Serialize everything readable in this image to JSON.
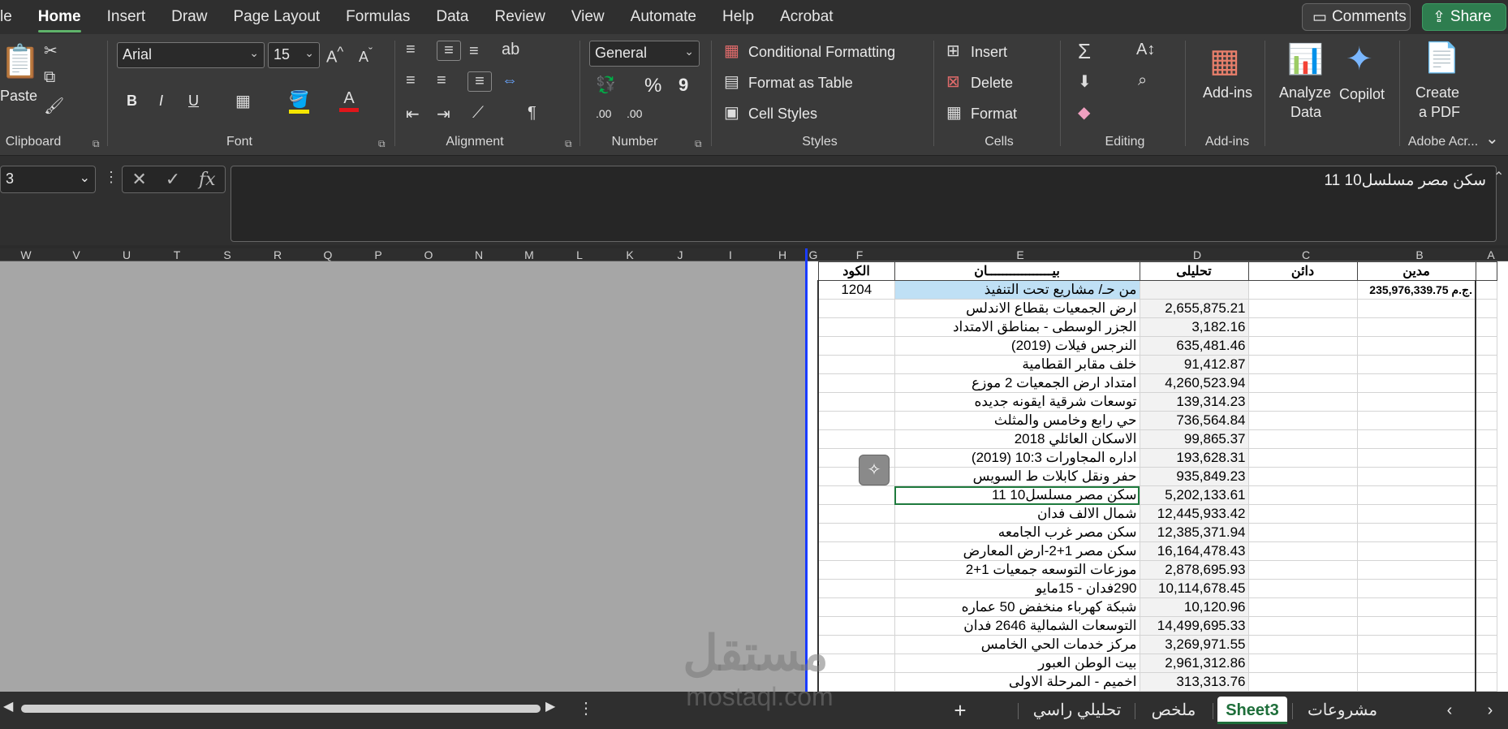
{
  "menubar": {
    "items": [
      "le",
      "Home",
      "Insert",
      "Draw",
      "Page Layout",
      "Formulas",
      "Data",
      "Review",
      "View",
      "Automate",
      "Help",
      "Acrobat"
    ],
    "comments": "Comments",
    "share": "Share"
  },
  "ribbon": {
    "clipboard": {
      "paste": "Paste",
      "label": "Clipboard"
    },
    "font": {
      "name": "Arial",
      "size": "15",
      "label": "Font",
      "bold": "B",
      "italic": "I",
      "underline": "U"
    },
    "alignment": {
      "label": "Alignment"
    },
    "number": {
      "format": "General",
      "label": "Number",
      "percent": "%",
      "comma": "9",
      "inc": ".00",
      "dec": ".00"
    },
    "styles": {
      "conditional": "Conditional Formatting",
      "format_table": "Format as Table",
      "cell_styles": "Cell Styles",
      "label": "Styles"
    },
    "cells": {
      "insert": "Insert",
      "delete": "Delete",
      "format": "Format",
      "label": "Cells"
    },
    "editing": {
      "label": "Editing"
    },
    "addins": {
      "title": "Add-ins",
      "label": "Add-ins"
    },
    "analyze": {
      "line1": "Analyze",
      "line2": "Data"
    },
    "copilot": {
      "title": "Copilot"
    },
    "acrobat": {
      "line1": "Create",
      "line2": "a PDF",
      "label": "Adobe Acr..."
    }
  },
  "formula_bar": {
    "namebox": "3",
    "fx": "fx",
    "content": "سكن مصر مسلسل10 11"
  },
  "columns": [
    "W",
    "V",
    "U",
    "T",
    "S",
    "R",
    "Q",
    "P",
    "O",
    "N",
    "M",
    "L",
    "K",
    "J",
    "I",
    "H",
    "G",
    "F",
    "E",
    "D",
    "C",
    "B",
    "A"
  ],
  "table": {
    "headers": {
      "code": "الكود",
      "statement": "بيـــــــــــــــــان",
      "analytic": "تحليلى",
      "credit": "دائن",
      "debit": "مدين"
    },
    "first_row": {
      "code": "1204",
      "statement": "من حـ/ مشاريع تحت التنفيذ",
      "debit": "235,976,339.75 ج.م."
    },
    "rows": [
      {
        "statement": "ارض الجمعيات بقطاع الاندلس",
        "value": "2,655,875.21"
      },
      {
        "statement": "الجزر الوسطى - بمناطق الامتداد",
        "value": "3,182.16"
      },
      {
        "statement": "النرجس فيلات (2019)",
        "value": "635,481.46"
      },
      {
        "statement": "خلف مقابر القطامية",
        "value": "91,412.87"
      },
      {
        "statement": "امتداد ارض الجمعيات 2 موزع",
        "value": "4,260,523.94"
      },
      {
        "statement": "توسعات شرقية ايقونه جديده",
        "value": "139,314.23"
      },
      {
        "statement": "حي رابع وخامس والمثلث",
        "value": "736,564.84"
      },
      {
        "statement": "الاسكان العائلي 2018",
        "value": "99,865.37"
      },
      {
        "statement": "اداره المجاورات 10:3 (2019)",
        "value": "193,628.31"
      },
      {
        "statement": "حفر ونقل كابلات ط السويس",
        "value": "935,849.23"
      },
      {
        "statement": "سكن مصر مسلسل10 11",
        "value": "5,202,133.61"
      },
      {
        "statement": "شمال الالف فدان",
        "value": "12,445,933.42"
      },
      {
        "statement": "سكن مصر غرب الجامعه",
        "value": "12,385,371.94"
      },
      {
        "statement": "سكن مصر 1+2-ارض المعارض",
        "value": "16,164,478.43"
      },
      {
        "statement": "موزعات التوسعه جمعيات 1+2",
        "value": "2,878,695.93"
      },
      {
        "statement": "290فدان - 15مايو",
        "value": "10,114,678.45"
      },
      {
        "statement": "شبكة كهرباء منخفض 50 عماره",
        "value": "10,120.96"
      },
      {
        "statement": "التوسعات الشمالية 2646 فدان",
        "value": "14,499,695.33"
      },
      {
        "statement": "مركز خدمات الحي الخامس",
        "value": "3,269,971.55"
      },
      {
        "statement": "بيت الوطن العبور",
        "value": "2,961,312.86"
      },
      {
        "statement": "اخميم - المرحلة الاولى",
        "value": "313,313.76"
      }
    ]
  },
  "tabs": [
    "تحليلي راسي",
    "ملخص",
    "Sheet3",
    "مشروعات"
  ],
  "watermark": {
    "line1": "مستقل",
    "line2": "mostaql.com"
  }
}
